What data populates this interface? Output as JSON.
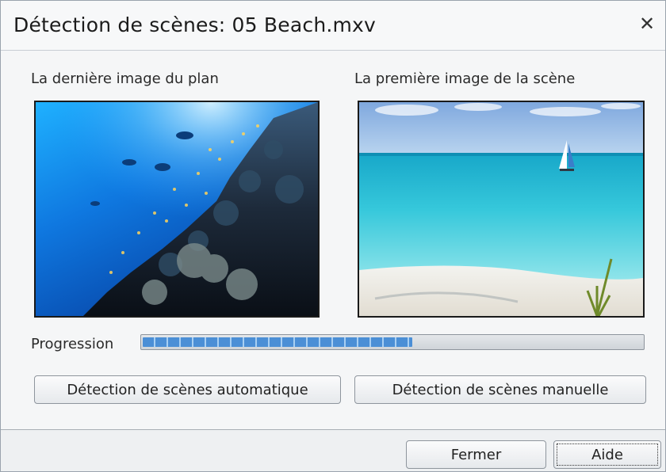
{
  "dialog": {
    "title": "Détection de scènes: 05 Beach.mxv",
    "close_symbol": "✕"
  },
  "left_panel": {
    "label": "La dernière image du plan",
    "image": "underwater-reef-image"
  },
  "right_panel": {
    "label": "La première image de la scène",
    "image": "beach-sailboat-image"
  },
  "progress": {
    "label": "Progression",
    "fraction": 0.54
  },
  "buttons": {
    "auto": "Détection de scènes automatique",
    "manual": "Détection de scènes manuelle",
    "close": "Fermer",
    "help": "Aide"
  }
}
